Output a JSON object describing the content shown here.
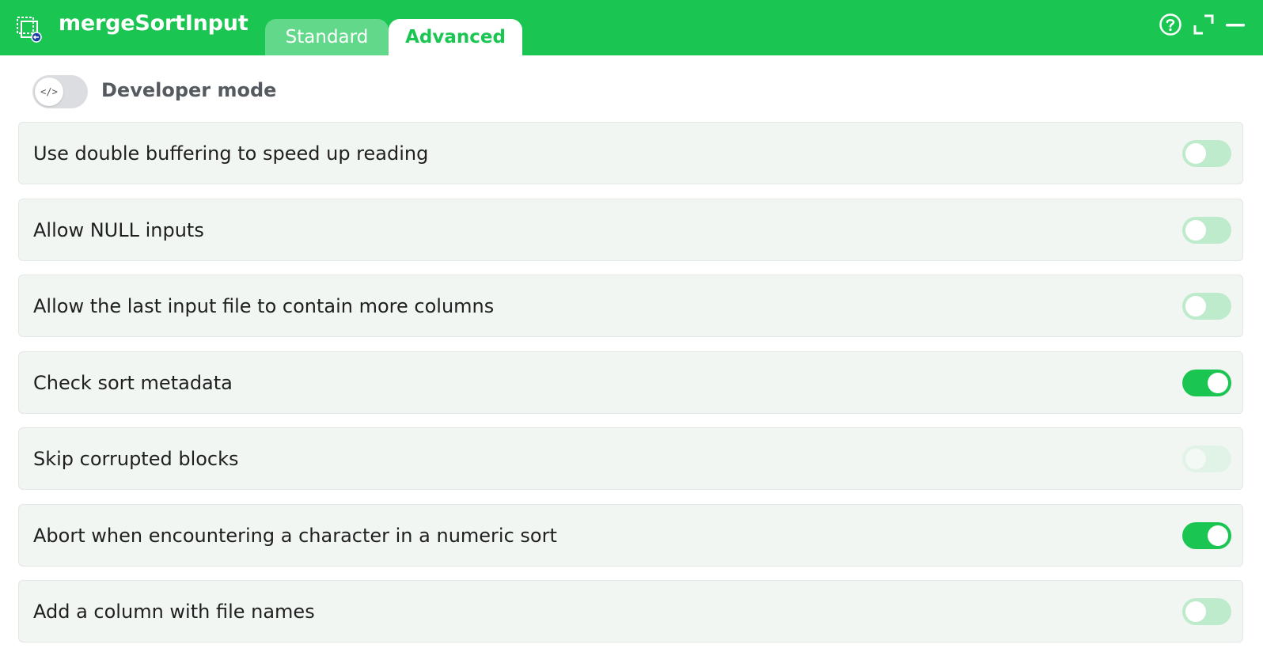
{
  "header": {
    "title": "mergeSortInput",
    "app_icon": "component-input-icon",
    "tabs": [
      {
        "label": "Standard",
        "active": false
      },
      {
        "label": "Advanced",
        "active": true
      }
    ],
    "buttons": [
      "help-icon",
      "maximize-icon",
      "minimize-icon"
    ]
  },
  "developer_mode": {
    "label": "Developer mode",
    "knob_text": "</>",
    "enabled": false
  },
  "options": [
    {
      "label": "Use double buffering to speed up reading",
      "state": "off"
    },
    {
      "label": "Allow NULL inputs",
      "state": "off"
    },
    {
      "label": "Allow the last input file to contain more columns",
      "state": "off"
    },
    {
      "label": "Check sort metadata",
      "state": "on"
    },
    {
      "label": "Skip corrupted blocks",
      "state": "disabled"
    },
    {
      "label": "Abort when encountering a character in a numeric sort",
      "state": "on"
    },
    {
      "label": "Add a column with file names",
      "state": "off"
    }
  ],
  "colors": {
    "accent": "#1bc552",
    "tab_inactive": "#62d98a",
    "row_bg": "#f2f6f3",
    "switch_off": "#bdebcb"
  }
}
